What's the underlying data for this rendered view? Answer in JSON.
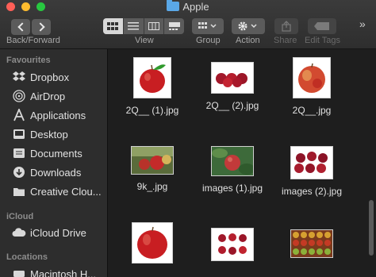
{
  "window": {
    "title": "Apple"
  },
  "toolbar": {
    "nav_label": "Back/Forward",
    "view_label": "View",
    "group_label": "Group",
    "action_label": "Action",
    "share_label": "Share",
    "tags_label": "Edit Tags",
    "more_glyph": "»"
  },
  "sidebar": {
    "favourites_header": "Favourites",
    "favourites": [
      {
        "label": "Dropbox",
        "icon": "dropbox-icon"
      },
      {
        "label": "AirDrop",
        "icon": "airdrop-icon"
      },
      {
        "label": "Applications",
        "icon": "applications-icon"
      },
      {
        "label": "Desktop",
        "icon": "desktop-icon"
      },
      {
        "label": "Documents",
        "icon": "documents-icon"
      },
      {
        "label": "Downloads",
        "icon": "downloads-icon"
      },
      {
        "label": "Creative Clou...",
        "icon": "folder-icon"
      }
    ],
    "icloud_header": "iCloud",
    "icloud": [
      {
        "label": "iCloud Drive",
        "icon": "cloud-icon"
      }
    ],
    "locations_header": "Locations",
    "locations": [
      {
        "label": "Macintosh H...",
        "icon": "disk-icon"
      }
    ]
  },
  "files": [
    {
      "name": "2Q__ (1).jpg"
    },
    {
      "name": "2Q__ (2).jpg"
    },
    {
      "name": "2Q__.jpg"
    },
    {
      "name": "9k_.jpg"
    },
    {
      "name": "images (1).jpg"
    },
    {
      "name": "images (2).jpg"
    },
    {
      "name": ""
    },
    {
      "name": ""
    },
    {
      "name": ""
    }
  ],
  "colors": {
    "accent_folder": "#5aa8e8",
    "apple_red": "#c81e22"
  }
}
